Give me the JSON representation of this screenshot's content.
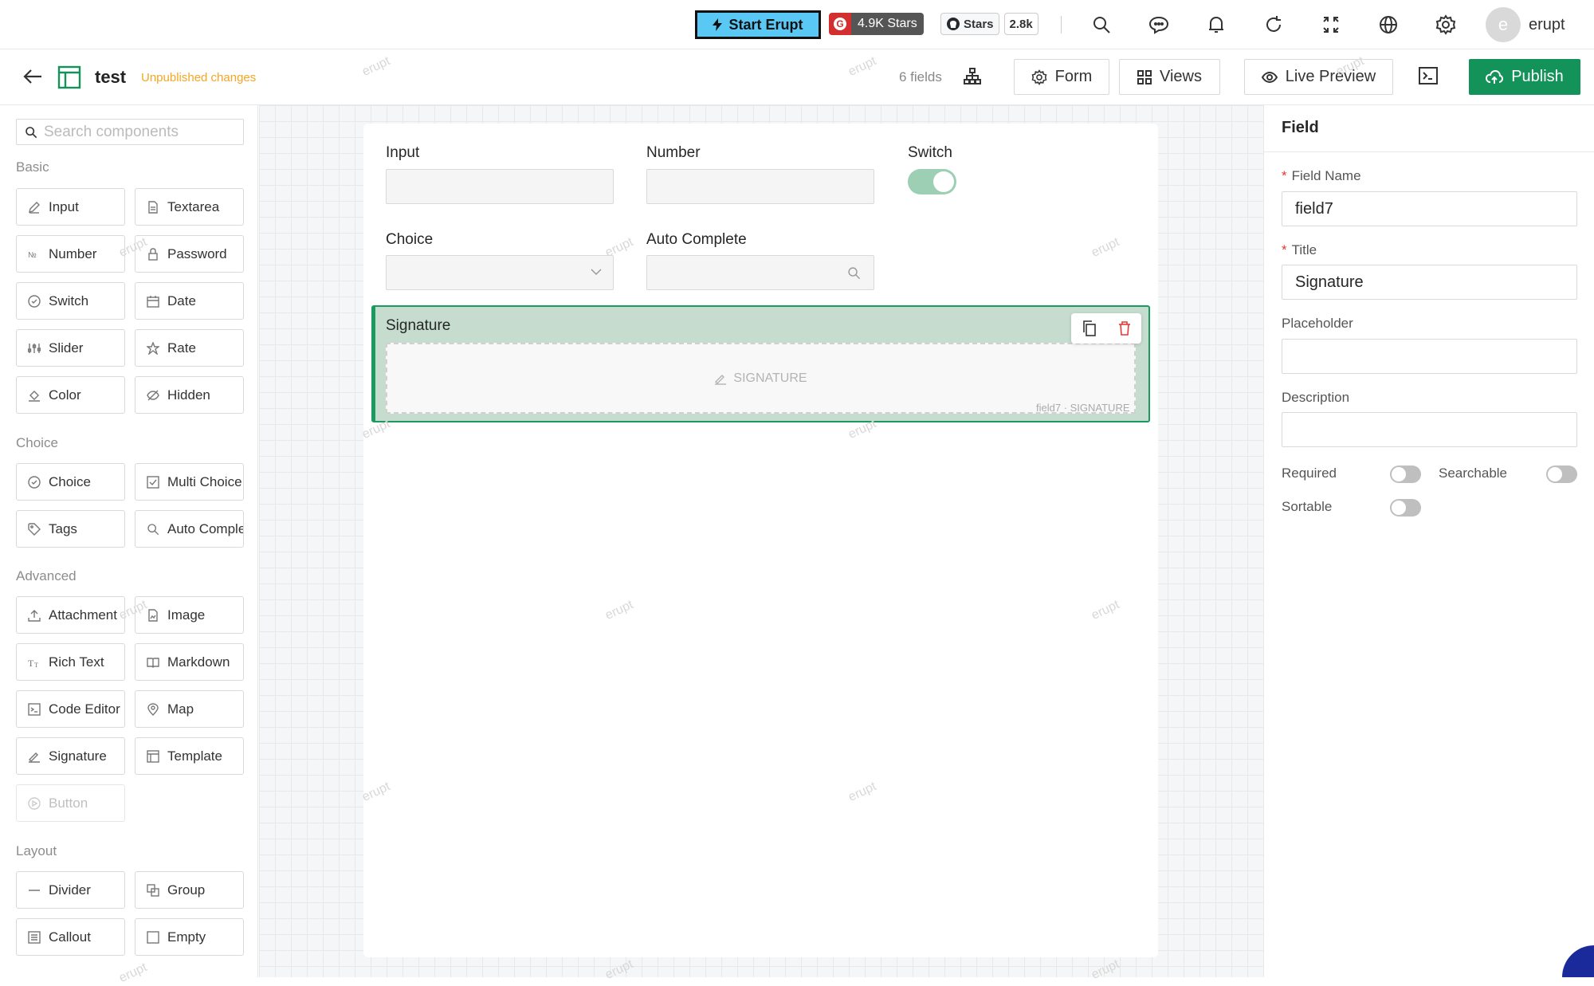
{
  "topbar": {
    "start_label": "Start Erupt",
    "stars_badge": "4.9K Stars",
    "github_stars_label": "Stars",
    "github_stars_count": "2.8k",
    "avatar_letter": "e",
    "username": "erupt"
  },
  "header": {
    "form_name": "test",
    "status": "Unpublished changes",
    "field_count": "6 fields",
    "form_btn": "Form",
    "views_btn": "Views",
    "preview_btn": "Live Preview",
    "publish_btn": "Publish"
  },
  "palette": {
    "search_placeholder": "Search components",
    "sections": {
      "basic": "Basic",
      "choice": "Choice",
      "advanced": "Advanced",
      "layout": "Layout"
    },
    "items": {
      "input": "Input",
      "textarea": "Textarea",
      "number": "Number",
      "password": "Password",
      "switch": "Switch",
      "date": "Date",
      "slider": "Slider",
      "rate": "Rate",
      "color": "Color",
      "hidden": "Hidden",
      "choice": "Choice",
      "multi_choice": "Multi Choice",
      "tags": "Tags",
      "auto_complete": "Auto Complete",
      "attachment": "Attachment",
      "image": "Image",
      "rich_text": "Rich Text",
      "markdown": "Markdown",
      "code_editor": "Code Editor",
      "map": "Map",
      "signature": "Signature",
      "template": "Template",
      "button": "Button",
      "divider": "Divider",
      "group": "Group",
      "callout": "Callout",
      "empty": "Empty"
    }
  },
  "canvas": {
    "fields": {
      "input": "Input",
      "number": "Number",
      "switch": "Switch",
      "choice": "Choice",
      "auto_complete": "Auto Complete",
      "signature": "Signature"
    },
    "switch_on": true,
    "signature_placeholder": "SIGNATURE",
    "signature_caption": "field7 · SIGNATURE",
    "watermark": "erupt"
  },
  "inspector": {
    "title": "Field",
    "field_name_label": "Field Name",
    "field_name_value": "field7",
    "title_label": "Title",
    "title_value": "Signature",
    "placeholder_label": "Placeholder",
    "placeholder_value": "",
    "description_label": "Description",
    "description_value": "",
    "required_label": "Required",
    "searchable_label": "Searchable",
    "sortable_label": "Sortable",
    "required_on": false,
    "searchable_on": false,
    "sortable_on": false
  },
  "colors": {
    "accent": "#13925a",
    "warning": "#f5a623",
    "danger": "#e53935",
    "start_button": "#5ac8f5"
  }
}
